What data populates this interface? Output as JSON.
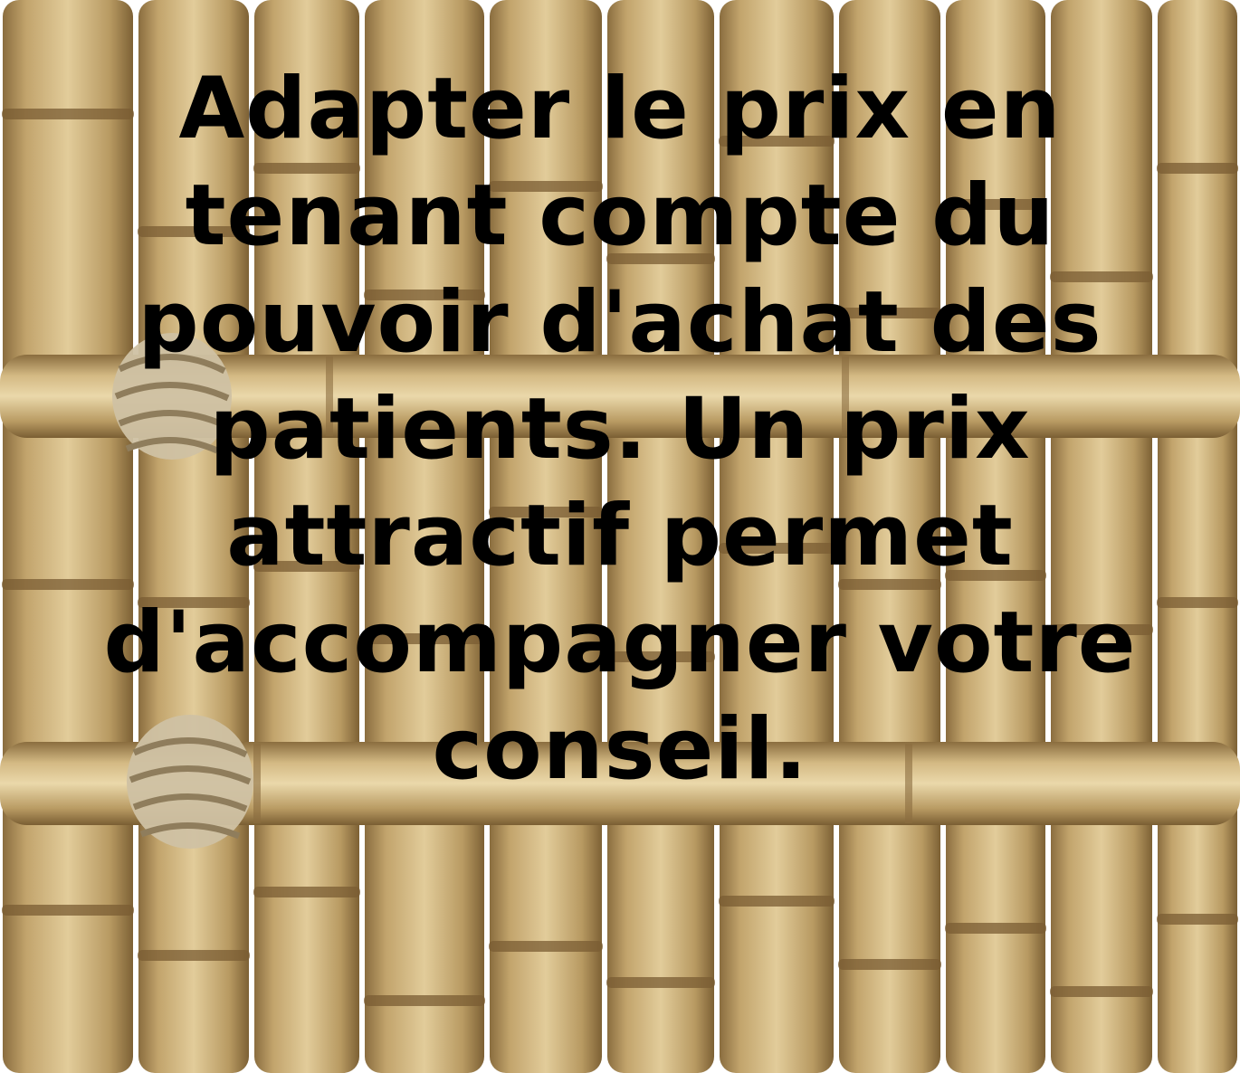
{
  "caption": {
    "lines": [
      "Adapter le prix en",
      "tenant compte du",
      "pouvoir d'achat des",
      "patients. Un prix",
      "attractif permet",
      "d'accompagner votre",
      "conseil."
    ]
  },
  "colors": {
    "text": "#000000",
    "bamboo_light": "#d8c08c",
    "bamboo_mid": "#b89a62",
    "bamboo_dark": "#8a6d3f",
    "node": "#7a5c33",
    "rope": "#cfc1a3",
    "background": "#ffffff"
  },
  "icons": {
    "background": "bamboo-fence-icon",
    "rope_knot": "rope-knot-icon"
  }
}
